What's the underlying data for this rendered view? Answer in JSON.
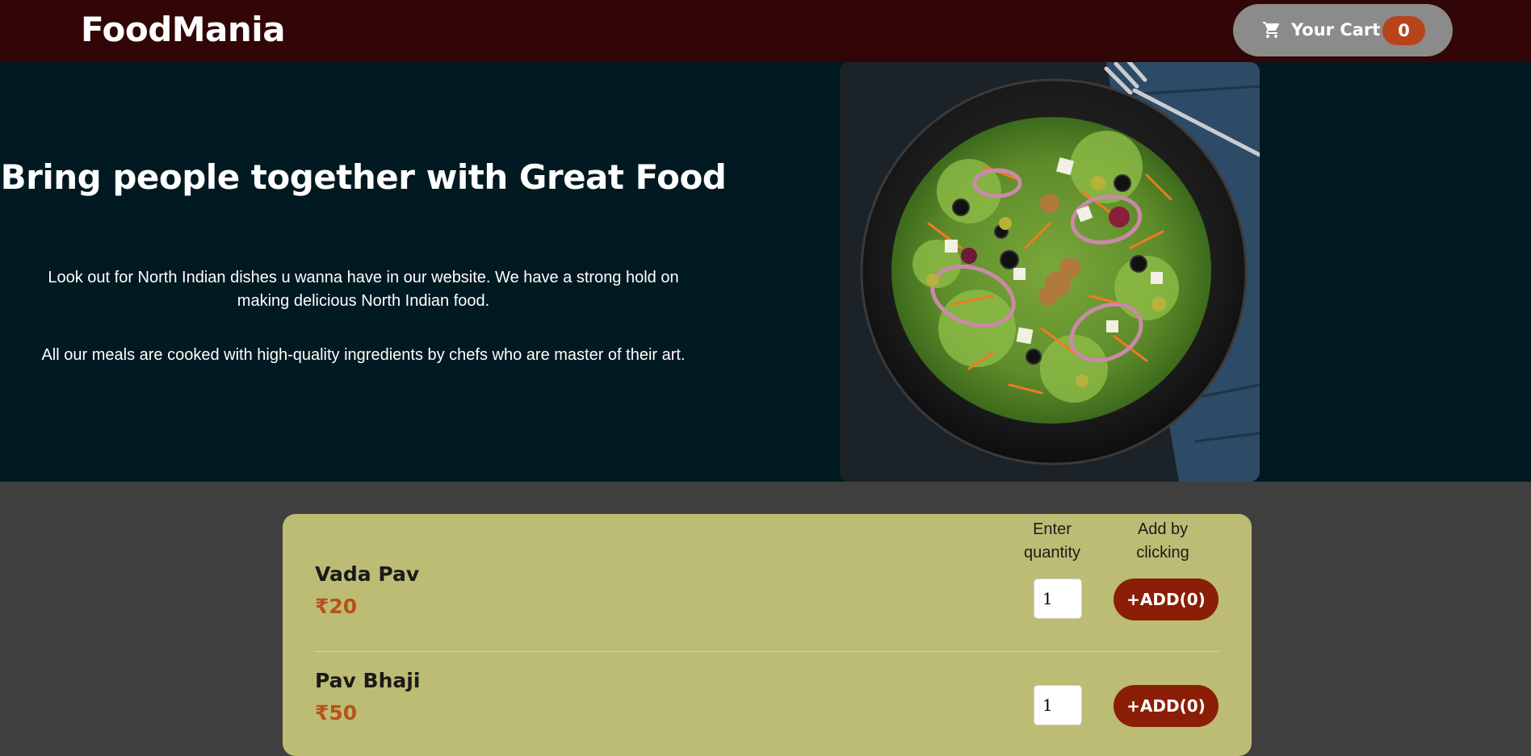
{
  "header": {
    "brand": "FoodMania",
    "cart_label": "Your Cart",
    "cart_count": "0"
  },
  "hero": {
    "title": "Bring people together with Great Food",
    "paragraph1": "Look out for North Indian dishes u wanna have in our website. We have a strong hold on making delicious North Indian food.",
    "paragraph2": "All our meals are cooked with high-quality ingredients by chefs who are master of their art."
  },
  "menu": {
    "qty_header": "Enter quantity",
    "add_header": "Add by clicking",
    "items": [
      {
        "name": "Vada Pav",
        "price": "₹20",
        "qty": "1",
        "add_label": "+ADD(0)"
      },
      {
        "name": "Pav Bhaji",
        "price": "₹50",
        "qty": "1",
        "add_label": "+ADD(0)"
      }
    ]
  },
  "colors": {
    "header_bg": "#320606",
    "hero_bg": "#011921",
    "page_bg": "#3f3f3f",
    "card_bg": "#bdbc74",
    "price": "#b7531a",
    "add_button": "#8a1e06",
    "cart_badge": "#b9441b"
  }
}
